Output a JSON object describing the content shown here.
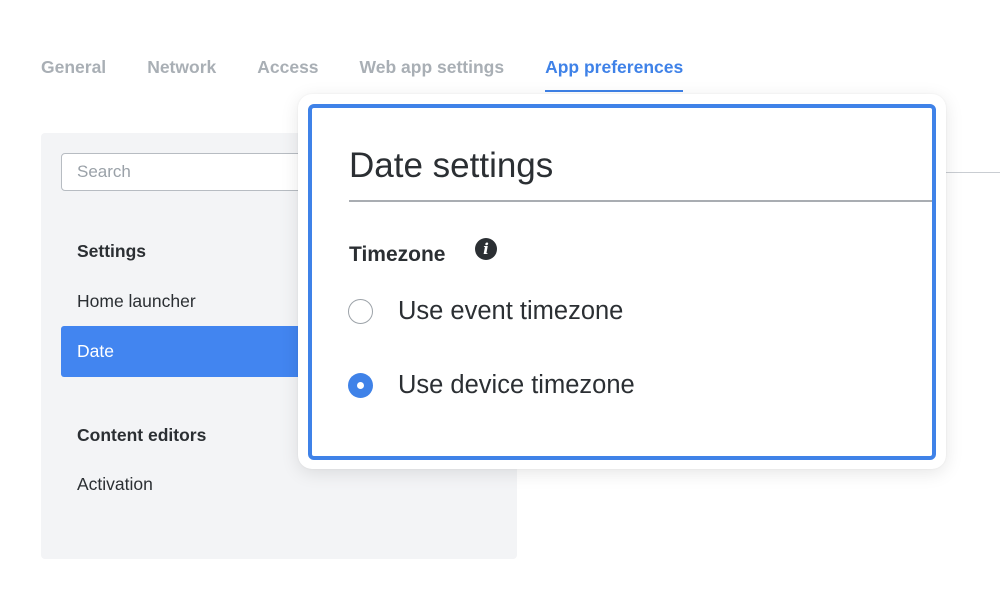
{
  "tabs": [
    {
      "label": "General",
      "active": false
    },
    {
      "label": "Network",
      "active": false
    },
    {
      "label": "Access",
      "active": false
    },
    {
      "label": "Web app settings",
      "active": false
    },
    {
      "label": "App preferences",
      "active": true
    }
  ],
  "sidebar": {
    "search_placeholder": "Search",
    "sections": [
      {
        "title": "Settings",
        "items": [
          {
            "label": "Home launcher",
            "active": false
          },
          {
            "label": "Date",
            "active": true
          }
        ]
      },
      {
        "title": "Content editors",
        "items": [
          {
            "label": "Activation",
            "active": false
          }
        ]
      }
    ]
  },
  "popup": {
    "title": "Date settings",
    "field_label": "Timezone",
    "info_icon": "info-icon",
    "options": [
      {
        "label": "Use event timezone",
        "selected": false
      },
      {
        "label": "Use device timezone",
        "selected": true
      }
    ]
  },
  "colors": {
    "accent": "#3f82e8",
    "active_nav_bg": "#4285f0",
    "inactive_tab": "#a9afb5",
    "panel_bg": "#f3f4f6"
  }
}
